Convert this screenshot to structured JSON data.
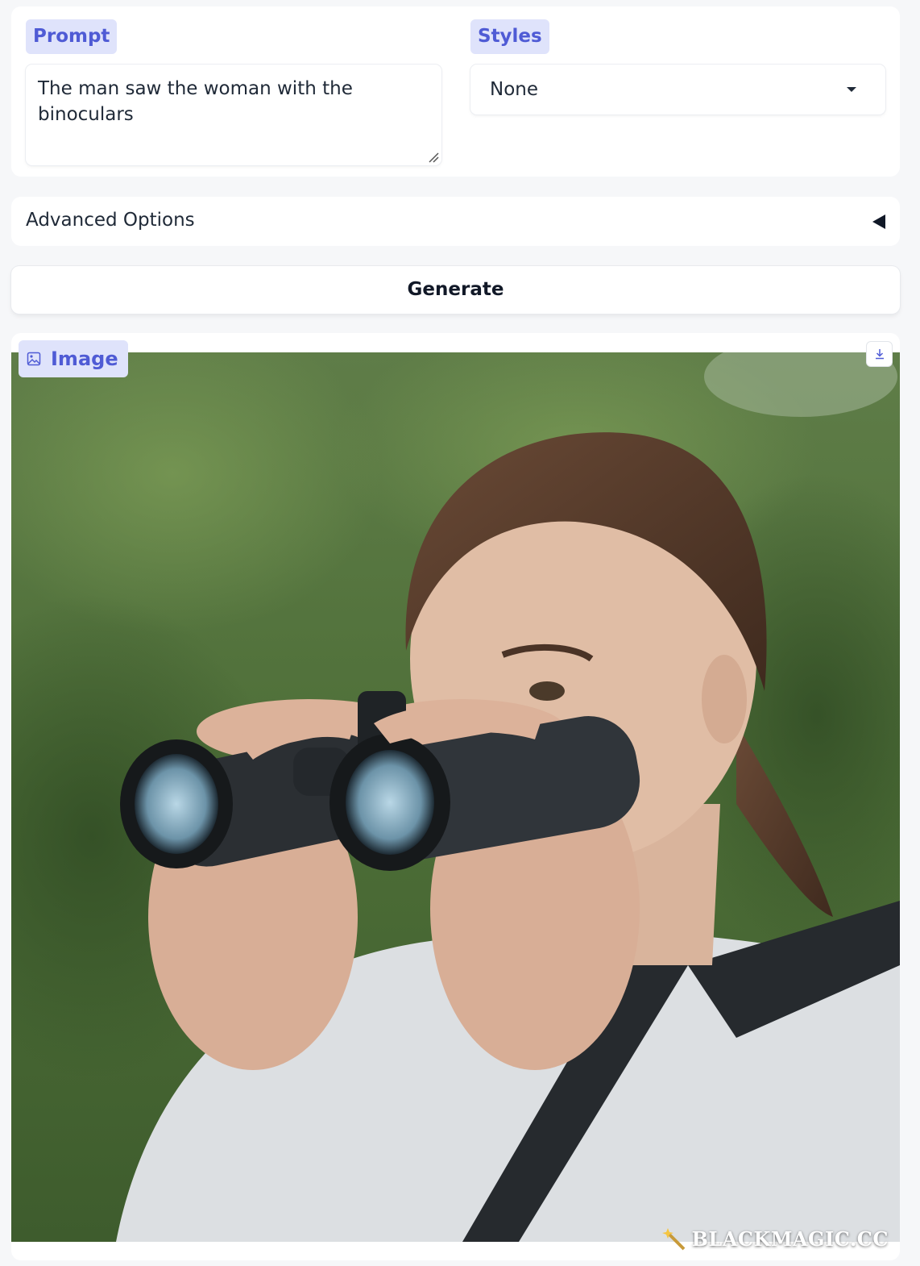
{
  "prompt": {
    "label": "Prompt",
    "value": "The man saw the woman with the binoculars"
  },
  "styles": {
    "label": "Styles",
    "selected": "None"
  },
  "advanced": {
    "label": "Advanced Options"
  },
  "generate": {
    "label": "Generate"
  },
  "output": {
    "label": "Image",
    "watermark": "BLACKMAGIC.CC"
  },
  "colors": {
    "accent": "#4f5bd5",
    "chip_bg": "#dfe3fb",
    "page_bg": "#f6f7f9"
  },
  "icons": [
    "image-icon",
    "download-icon",
    "dropdown-caret-icon",
    "collapse-arrow-icon",
    "resize-grip-icon",
    "wand-icon"
  ]
}
